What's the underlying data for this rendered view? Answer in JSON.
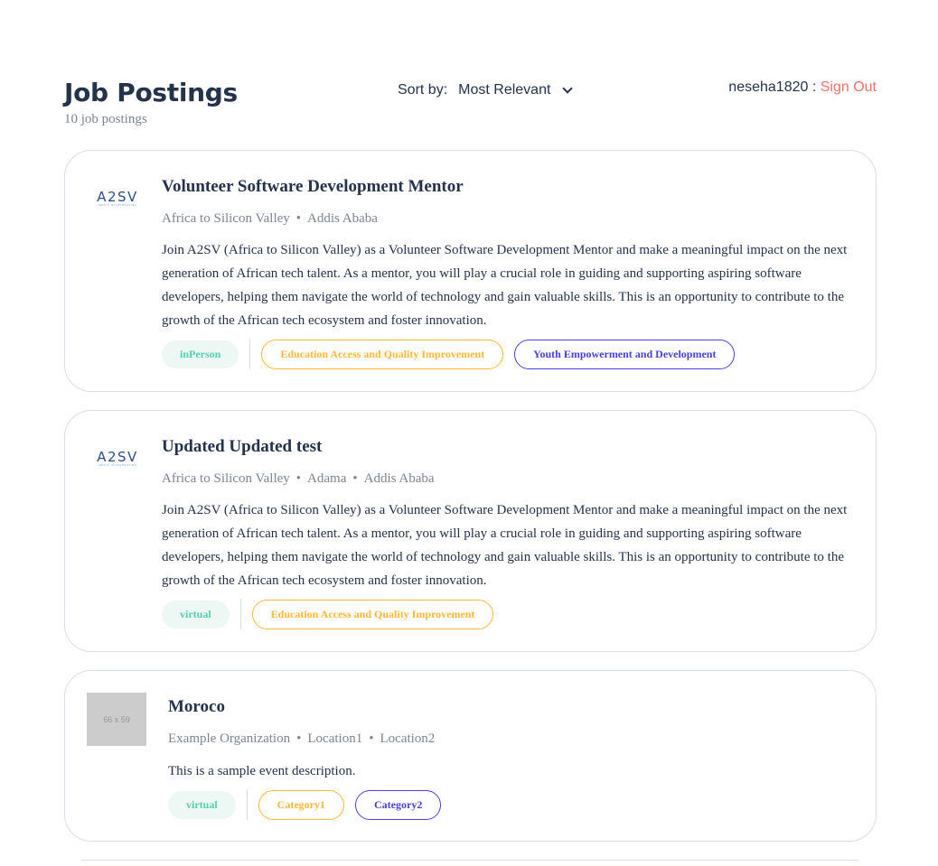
{
  "header": {
    "title": "Job Postings",
    "count": "10 job postings",
    "sort_label": "Sort by:",
    "sort_value": "Most Relevant",
    "username": "neseha1820",
    "separator": " : ",
    "sign_out": "Sign Out"
  },
  "jobs": [
    {
      "logo": "A2SV",
      "logo_sub": "ABOUT ACCELERATING",
      "title": "Volunteer Software Development Mentor",
      "org": "Africa to Silicon Valley",
      "locations": [
        "Addis Ababa"
      ],
      "description": "Join A2SV (Africa to Silicon Valley) as a Volunteer Software Development Mentor and make a meaningful impact on the next generation of African tech talent. As a mentor, you will play a crucial role in guiding and supporting aspiring software developers, helping them navigate the world of technology and gain valuable skills. This is an opportunity to contribute to the growth of the African tech ecosystem and foster innovation.",
      "mode": "inPerson",
      "categories": [
        "Education Access and Quality Improvement",
        "Youth Empowerment and Development"
      ]
    },
    {
      "logo": "A2SV",
      "logo_sub": "ABOUT ACCELERATING",
      "title": "Updated Updated test",
      "org": "Africa to Silicon Valley",
      "locations": [
        "Adama",
        "Addis Ababa"
      ],
      "description": "Join A2SV (Africa to Silicon Valley) as a Volunteer Software Development Mentor and make a meaningful impact on the next generation of African tech talent. As a mentor, you will play a crucial role in guiding and supporting aspiring software developers, helping them navigate the world of technology and gain valuable skills. This is an opportunity to contribute to the growth of the African tech ecosystem and foster innovation.",
      "mode": "virtual",
      "categories": [
        "Education Access and Quality Improvement"
      ]
    },
    {
      "logo_placeholder": "66 x 59",
      "title": "Moroco",
      "org": "Example Organization",
      "locations": [
        "Location1",
        "Location2"
      ],
      "description": "This is a sample event description.",
      "mode": "virtual",
      "categories": [
        "Category1",
        "Category2"
      ]
    }
  ],
  "colors": {
    "mode_tag": "#56cdad",
    "category_primary": "#ffb836",
    "category_secondary": "#4640de",
    "sign_out": "#f0706a"
  }
}
